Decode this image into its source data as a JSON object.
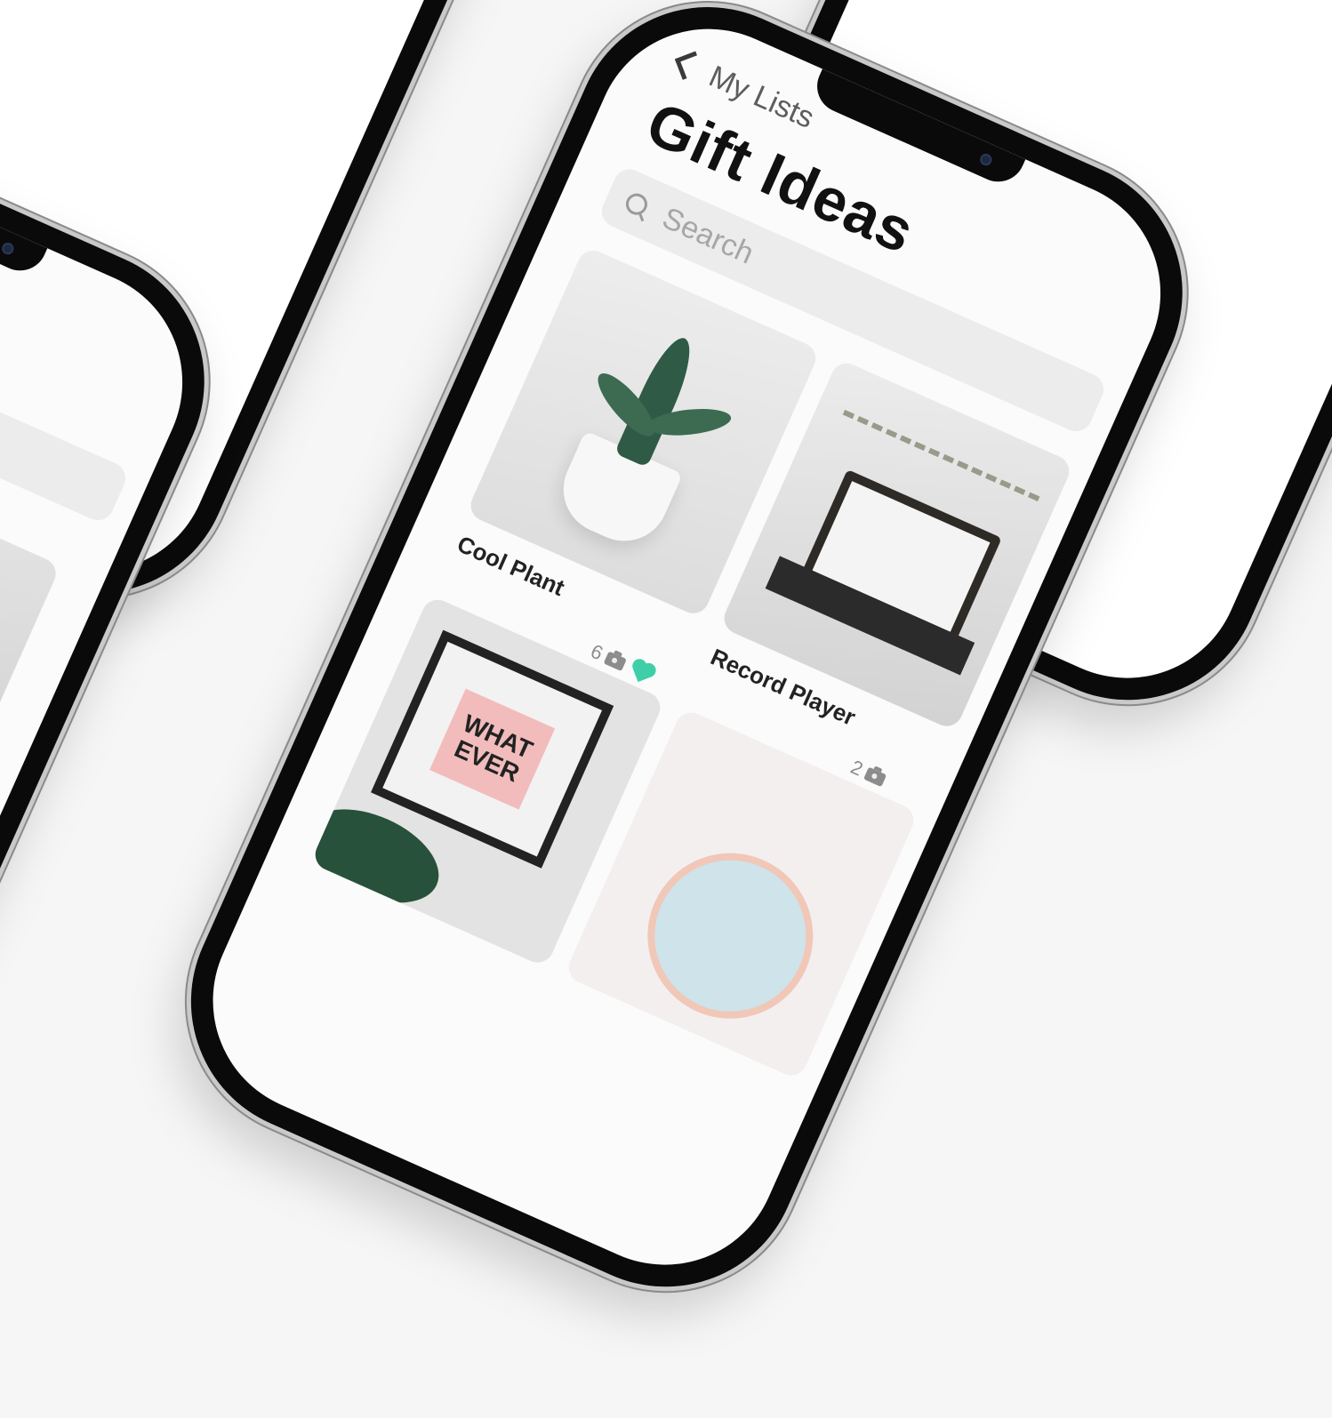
{
  "nav": {
    "back_label": "My Lists"
  },
  "page": {
    "title": "Gift Ideas"
  },
  "search": {
    "placeholder": "Search"
  },
  "items": [
    {
      "name": "Cool Plant",
      "photo_count": "6",
      "favorited": true
    },
    {
      "name": "Record Player",
      "photo_count": "2",
      "favorited": false
    },
    {
      "name": "WHAT EVER print",
      "print_text": "WHAT EVER"
    }
  ],
  "colors": {
    "favorite": "#3fcfa8",
    "background": "#f6f6f6"
  },
  "icons": [
    "chevron-left-icon",
    "search-icon",
    "camera-icon",
    "heart-icon",
    "gear-icon"
  ]
}
